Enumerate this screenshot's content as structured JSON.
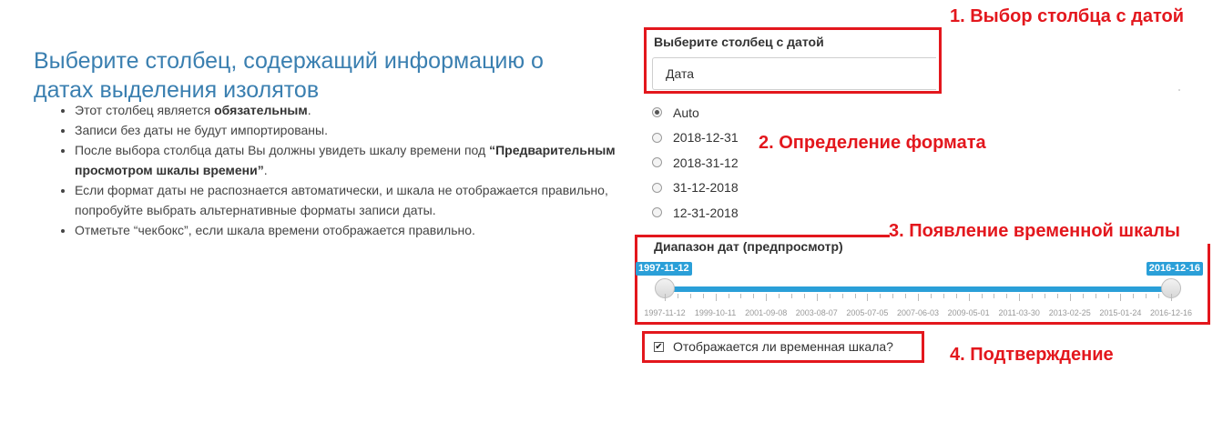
{
  "heading": "Выберите столбец, содержащий информацию о датах выделения изолятов",
  "bullets": {
    "b1_pre": "Этот столбец является ",
    "b1_bold": "обязательным",
    "b1_post": ".",
    "b2": "Записи без даты не будут импортированы.",
    "b3_pre": "После выбора столбца даты Вы должны увидеть шкалу времени под ",
    "b3_bold": "“Предварительным просмотром шкалы времени”",
    "b3_post": ".",
    "b4": "Если формат даты не распознается автоматически, и шкала не отображается правильно, попробуйте выбрать альтернативные форматы записи даты.",
    "b5": "Отметьте “чекбокс”, если шкала времени отображается правильно."
  },
  "date_column": {
    "label": "Выберите столбец с датой",
    "value": "Дата"
  },
  "formats": [
    {
      "label": "Auto",
      "checked": true
    },
    {
      "label": "2018-12-31",
      "checked": false
    },
    {
      "label": "2018-31-12",
      "checked": false
    },
    {
      "label": "31-12-2018",
      "checked": false
    },
    {
      "label": "12-31-2018",
      "checked": false
    }
  ],
  "range": {
    "label": "Диапазон дат (предпросмотр)",
    "from": "1997-11-12",
    "to": "2016-12-16",
    "from_position": 0.0,
    "to_position": 1.0,
    "ticks": [
      "1997-11-12",
      "1999-10-11",
      "2001-09-08",
      "2003-08-07",
      "2005-07-05",
      "2007-06-03",
      "2009-05-01",
      "2011-03-30",
      "2013-02-25",
      "2015-01-24",
      "2016-12-16"
    ]
  },
  "confirm": {
    "label": "Отображается ли временная шкала?",
    "checked": true
  },
  "annotations": {
    "a1": "1. Выбор столбца с датой",
    "a2": "2. Определение формата",
    "a3": "3. Появление временной шкалы",
    "a4": "4. Подтверждение"
  },
  "colors": {
    "accent": "#2a9fd8",
    "annotation": "#e3171d",
    "heading": "#3a7fb0"
  }
}
